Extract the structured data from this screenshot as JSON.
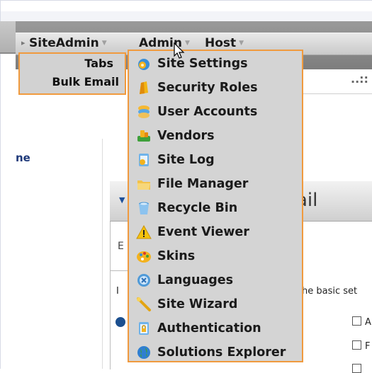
{
  "menubar": {
    "items": [
      {
        "label": "SiteAdmin"
      },
      {
        "label": "Admin"
      },
      {
        "label": "Host"
      }
    ]
  },
  "siteadmin_menu": {
    "items": [
      {
        "label": "Tabs"
      },
      {
        "label": "Bulk Email"
      }
    ]
  },
  "admin_menu": {
    "items": [
      {
        "label": "Site Settings",
        "icon": "site-settings-icon"
      },
      {
        "label": "Security Roles",
        "icon": "security-roles-icon"
      },
      {
        "label": "User Accounts",
        "icon": "user-accounts-icon"
      },
      {
        "label": "Vendors",
        "icon": "vendors-icon"
      },
      {
        "label": "Site Log",
        "icon": "site-log-icon"
      },
      {
        "label": "File Manager",
        "icon": "folder-icon"
      },
      {
        "label": "Recycle Bin",
        "icon": "recycle-bin-icon"
      },
      {
        "label": "Event Viewer",
        "icon": "warning-icon"
      },
      {
        "label": "Skins",
        "icon": "skins-icon"
      },
      {
        "label": "Languages",
        "icon": "languages-icon"
      },
      {
        "label": "Site Wizard",
        "icon": "wand-icon"
      },
      {
        "label": "Authentication",
        "icon": "authentication-icon"
      },
      {
        "label": "Solutions Explorer",
        "icon": "globe-icon"
      }
    ]
  },
  "background": {
    "left_link": "ne",
    "module_title": "ail",
    "module_e": "E",
    "intro_start": "I",
    "intro_text": "he basic set",
    "dots": "..::",
    "checkbox_labels": [
      "A",
      "F"
    ]
  },
  "colors": {
    "menu_border": "#f09a3e",
    "menu_bg": "#d4d4d4"
  }
}
